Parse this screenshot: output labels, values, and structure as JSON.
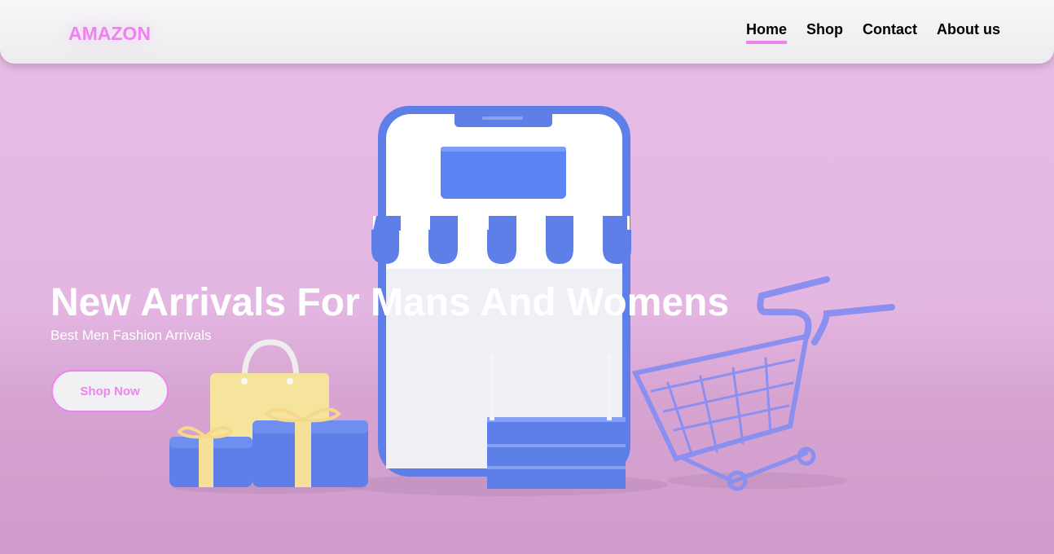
{
  "brand": {
    "logo_text": "AMAZON",
    "accent_color": "#ee82ee"
  },
  "nav": {
    "items": [
      {
        "label": "Home",
        "active": true
      },
      {
        "label": "Shop",
        "active": false
      },
      {
        "label": "Contact",
        "active": false
      },
      {
        "label": "About us",
        "active": false
      }
    ]
  },
  "hero": {
    "title": "New Arrivals For Mans And Womens",
    "subtitle": "Best Men Fashion Arrivals",
    "cta_label": "Shop Now",
    "background_color": "#e6b8e4"
  }
}
